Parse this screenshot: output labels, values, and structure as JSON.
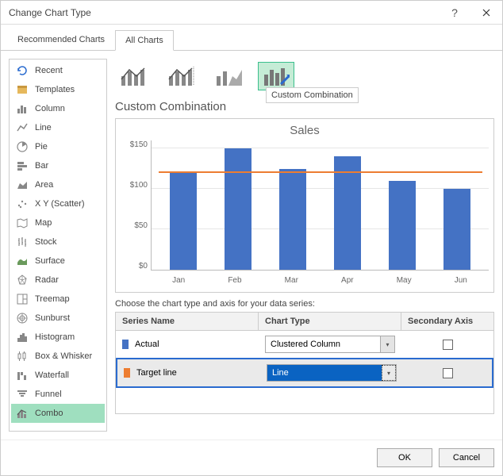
{
  "window": {
    "title": "Change Chart Type"
  },
  "tabs": {
    "recommended": "Recommended Charts",
    "all": "All Charts"
  },
  "sidebar": {
    "items": [
      {
        "label": "Recent"
      },
      {
        "label": "Templates"
      },
      {
        "label": "Column"
      },
      {
        "label": "Line"
      },
      {
        "label": "Pie"
      },
      {
        "label": "Bar"
      },
      {
        "label": "Area"
      },
      {
        "label": "X Y (Scatter)"
      },
      {
        "label": "Map"
      },
      {
        "label": "Stock"
      },
      {
        "label": "Surface"
      },
      {
        "label": "Radar"
      },
      {
        "label": "Treemap"
      },
      {
        "label": "Sunburst"
      },
      {
        "label": "Histogram"
      },
      {
        "label": "Box & Whisker"
      },
      {
        "label": "Waterfall"
      },
      {
        "label": "Funnel"
      },
      {
        "label": "Combo"
      }
    ]
  },
  "main": {
    "section_title": "Custom Combination",
    "tooltip": "Custom Combination",
    "series_label": "Choose the chart type and axis for your data series:",
    "headers": {
      "name": "Series Name",
      "type": "Chart Type",
      "axis": "Secondary Axis"
    },
    "series": [
      {
        "name": "Actual",
        "type": "Clustered Column",
        "color": "#4472c4"
      },
      {
        "name": "Target line",
        "type": "Line",
        "color": "#ed7d31"
      }
    ]
  },
  "footer": {
    "ok": "OK",
    "cancel": "Cancel"
  },
  "chart_data": {
    "type": "bar",
    "title": "Sales",
    "categories": [
      "Jan",
      "Feb",
      "Mar",
      "Apr",
      "May",
      "Jun"
    ],
    "series": [
      {
        "name": "Actual",
        "type": "bar",
        "values": [
          120,
          150,
          125,
          140,
          110,
          100
        ]
      },
      {
        "name": "Target line",
        "type": "line",
        "values": [
          120,
          120,
          120,
          120,
          120,
          120
        ]
      }
    ],
    "ylabel": "",
    "ylim": [
      0,
      160
    ],
    "yticks": [
      "$0",
      "$50",
      "$100",
      "$150"
    ]
  }
}
